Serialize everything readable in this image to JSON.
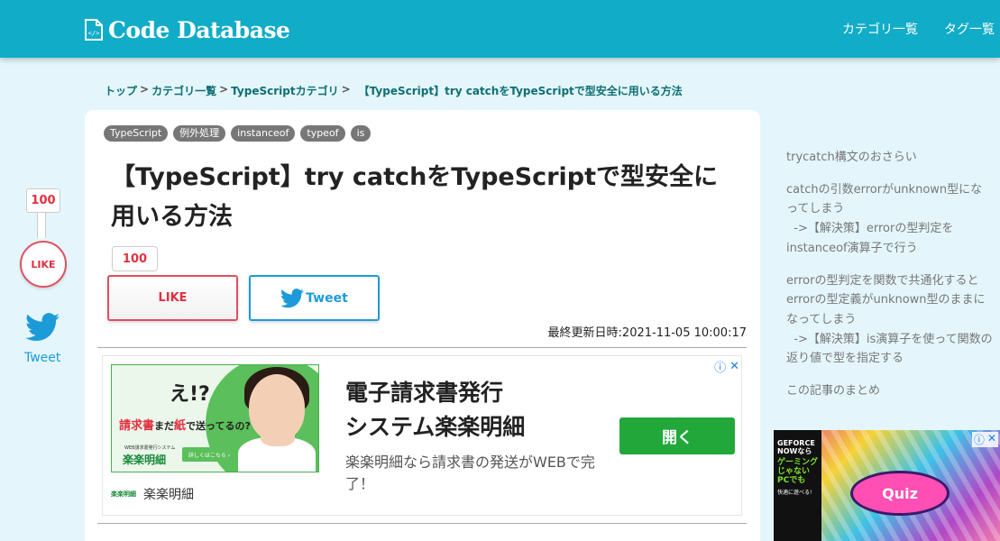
{
  "header": {
    "logo_text": "Code Database",
    "nav": [
      "カテゴリ一覧",
      "タグ一覧"
    ]
  },
  "breadcrumb": [
    "トップ",
    "カテゴリ一覧",
    "TypeScriptカテゴリ",
    "【TypeScript】try catchをTypeScriptで型安全に用いる方法"
  ],
  "article": {
    "tags": [
      "TypeScript",
      "例外処理",
      "instanceof",
      "typeof",
      "is"
    ],
    "title": "【TypeScript】try catchをTypeScriptで型安全に用いる方法",
    "like_count": "100",
    "like_label": "LIKE",
    "tweet_label": "Tweet",
    "updated": "最終更新日時:2021-11-05 10:00:17"
  },
  "ad": {
    "headline_1": "電子請求書発行",
    "headline_2": "システム楽楽明細",
    "description": "楽楽明細なら請求書の発送がWEBで完了！",
    "open_label": "開く",
    "brand": "楽楽明細",
    "image_exclaim": "え!?",
    "image_text_a": "請求書",
    "image_text_b": "まだ",
    "image_text_c": "紙",
    "image_text_d": "で送ってるの?",
    "image_brand": "楽楽明細",
    "image_small": "WEB請求書発行システム",
    "image_button": "詳しくはこちら ›",
    "brand_logo_text": "楽楽明細"
  },
  "side_share": {
    "like_count": "100",
    "like_label": "LIKE",
    "tweet_label": "Tweet"
  },
  "toc": {
    "items": [
      {
        "text": "trycatch構文のおさらい",
        "sub": ""
      },
      {
        "text": "catchの引数errorがunknown型になってしまう",
        "sub": "->【解決策】errorの型判定をinstanceof演算子で行う"
      },
      {
        "text": "errorの型判定を関数で共通化するとerrorの型定義がunknown型のままになってしまう",
        "sub": "->【解決策】is演算子を使って関数の返り値で型を指定する"
      },
      {
        "text": "この記事のまとめ",
        "sub": ""
      }
    ]
  },
  "side_ad": {
    "line1": "GEFORCE NOWなら",
    "line2": "ゲーミングじゃないPCでも",
    "line3": "快適に遊べる!",
    "quiz": "Quiz"
  },
  "colors": {
    "header_bg": "#11acc8",
    "page_bg": "#e4f6fb",
    "breadcrumb": "#0e6f74",
    "like": "#e03040",
    "tweet": "#1d9bd8",
    "ad_button": "#22a83a"
  }
}
